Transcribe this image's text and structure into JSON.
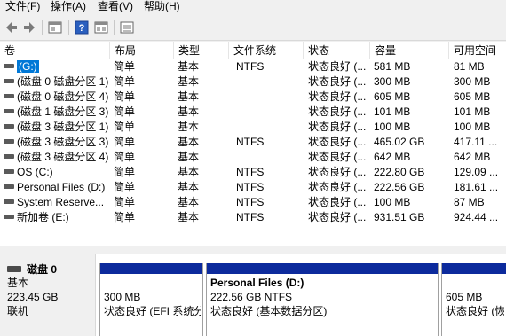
{
  "menu": [
    {
      "label": "文件(F)"
    },
    {
      "label": "操作(A)"
    },
    {
      "label": "查看(V)"
    },
    {
      "label": "帮助(H)"
    }
  ],
  "toolbar": {
    "icons": [
      "back-arrow-icon",
      "forward-arrow-icon",
      "properties-icon",
      "help-icon",
      "view-icon",
      "list-icon"
    ]
  },
  "columns": [
    "卷",
    "布局",
    "类型",
    "文件系统",
    "状态",
    "容量",
    "可用空间"
  ],
  "rows": [
    {
      "volume": "(G:)",
      "layout": "简单",
      "type": "基本",
      "fs": "NTFS",
      "status": "状态良好 (...",
      "capacity": "581 MB",
      "free": "81 MB",
      "selected": true
    },
    {
      "volume": "(磁盘 0 磁盘分区 1)",
      "layout": "简单",
      "type": "基本",
      "fs": "",
      "status": "状态良好 (...",
      "capacity": "300 MB",
      "free": "300 MB",
      "selected": false
    },
    {
      "volume": "(磁盘 0 磁盘分区 4)",
      "layout": "简单",
      "type": "基本",
      "fs": "",
      "status": "状态良好 (...",
      "capacity": "605 MB",
      "free": "605 MB",
      "selected": false
    },
    {
      "volume": "(磁盘 1 磁盘分区 3)",
      "layout": "简单",
      "type": "基本",
      "fs": "",
      "status": "状态良好 (...",
      "capacity": "101 MB",
      "free": "101 MB",
      "selected": false
    },
    {
      "volume": "(磁盘 3 磁盘分区 1)",
      "layout": "简单",
      "type": "基本",
      "fs": "",
      "status": "状态良好 (...",
      "capacity": "100 MB",
      "free": "100 MB",
      "selected": false
    },
    {
      "volume": "(磁盘 3 磁盘分区 3)",
      "layout": "简单",
      "type": "基本",
      "fs": "NTFS",
      "status": "状态良好 (...",
      "capacity": "465.02 GB",
      "free": "417.11 ...",
      "selected": false
    },
    {
      "volume": "(磁盘 3 磁盘分区 4)",
      "layout": "简单",
      "type": "基本",
      "fs": "",
      "status": "状态良好 (...",
      "capacity": "642 MB",
      "free": "642 MB",
      "selected": false
    },
    {
      "volume": "OS (C:)",
      "layout": "简单",
      "type": "基本",
      "fs": "NTFS",
      "status": "状态良好 (...",
      "capacity": "222.80 GB",
      "free": "129.09 ...",
      "selected": false
    },
    {
      "volume": "Personal Files (D:)",
      "layout": "简单",
      "type": "基本",
      "fs": "NTFS",
      "status": "状态良好 (...",
      "capacity": "222.56 GB",
      "free": "181.61 ...",
      "selected": false
    },
    {
      "volume": "System Reserve...",
      "layout": "简单",
      "type": "基本",
      "fs": "NTFS",
      "status": "状态良好 (...",
      "capacity": "100 MB",
      "free": "87 MB",
      "selected": false
    },
    {
      "volume": "新加卷 (E:)",
      "layout": "简单",
      "type": "基本",
      "fs": "NTFS",
      "status": "状态良好 (...",
      "capacity": "931.51 GB",
      "free": "924.44 ...",
      "selected": false
    }
  ],
  "disk": {
    "name": "磁盘 0",
    "type": "基本",
    "size": "223.45 GB",
    "status": "联机"
  },
  "partitions": [
    {
      "title": "",
      "line1": "300 MB",
      "line2": "状态良好 (EFI 系统分"
    },
    {
      "title": "Personal Files  (D:)",
      "line1": "222.56 GB NTFS",
      "line2": "状态良好 (基本数据分区)"
    },
    {
      "title": "",
      "line1": "605 MB",
      "line2": "状态良好 (恢"
    }
  ],
  "colors": {
    "selection": "#0078d7",
    "partition_bar": "#0c2a9c"
  }
}
